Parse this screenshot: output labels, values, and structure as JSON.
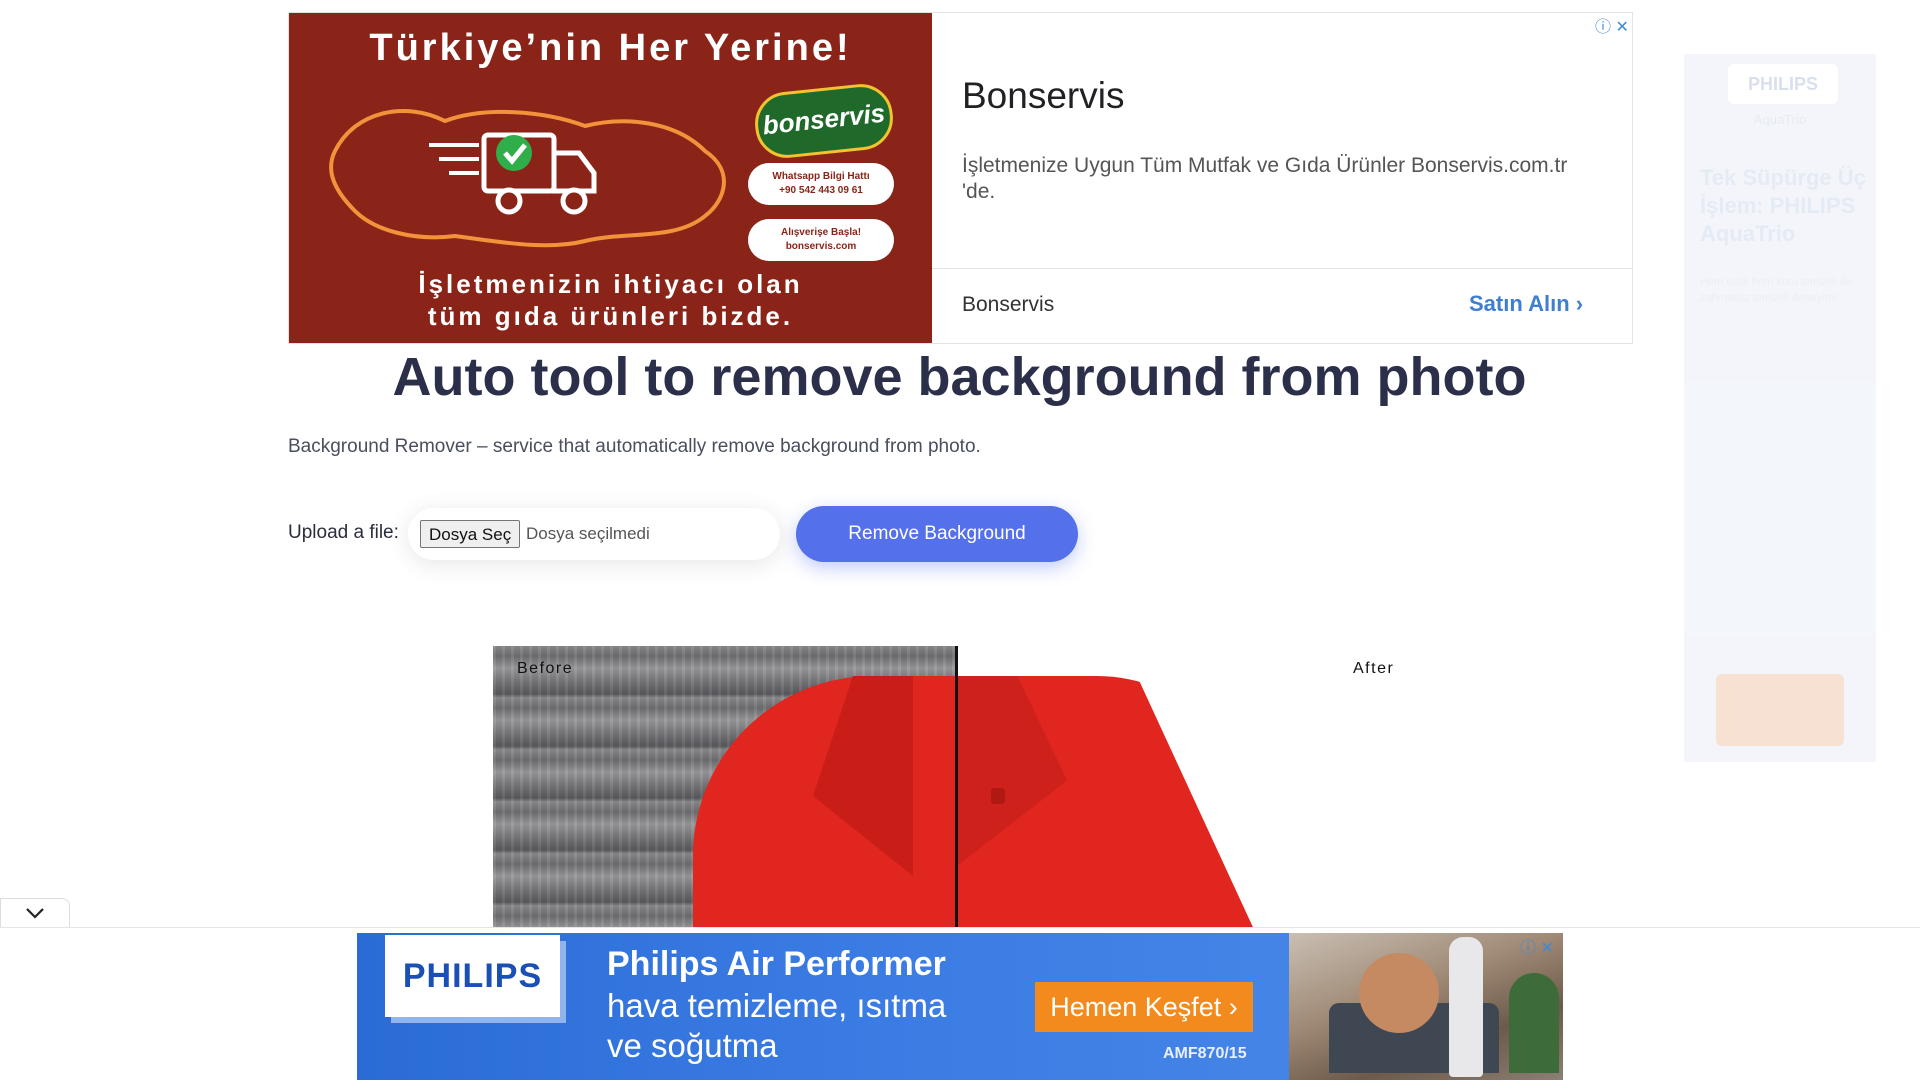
{
  "top_ad": {
    "image_headline": "Türkiye’nin Her Yerine!",
    "image_tagline_1": "İşletmenizin ihtiyacı olan",
    "image_tagline_2": "tüm gıda ürünleri bizde.",
    "image_logo": "bonservis",
    "image_pill_1_title": "Whatsapp Bilgi Hattı",
    "image_pill_1_value": "+90 542 443 09 61",
    "image_pill_2_title": "Alışverişe Başla!",
    "image_pill_2_value": "bonservis.com",
    "title": "Bonservis",
    "description": "İşletmenize Uygun Tüm Mutfak ve Gıda Ürünler Bonservis.com.tr 'de.",
    "advertiser": "Bonservis",
    "cta": "Satın Alın ›",
    "close_icons": "ⓘ ✕"
  },
  "side_ad": {
    "logo": "PHILIPS",
    "sub": "AquaTrio",
    "headline": "Tek Süpürge Üç İşlem: PHILIPS AquaTrio",
    "description": "Hem ıslak hem kuru temizlik ile zahmetsiz temizlik deneyimi"
  },
  "main": {
    "title": "Auto tool to remove background from photo",
    "subtitle": "Background Remover – service that automatically remove background from photo.",
    "upload_label": "Upload a file:",
    "file_button": "Dosya Seç",
    "file_status": "Dosya seçilmedi",
    "remove_button": "Remove Background"
  },
  "compare": {
    "before_label": "Before",
    "after_label": "After"
  },
  "bottom_ad": {
    "logo": "PHILIPS",
    "line1": "Philips Air Performer",
    "line2": "hava temizleme, ısıtma",
    "line3": "ve soğutma",
    "cta": "Hemen Keşfet ›",
    "model": "AMF870/15",
    "close_icons": "ⓘ ✕"
  },
  "colors": {
    "accent": "#5470ea",
    "title": "#2c2f4a",
    "ad_red": "#8a2418",
    "philips_blue": "#2a6bd6",
    "philips_orange": "#f28a1e"
  }
}
